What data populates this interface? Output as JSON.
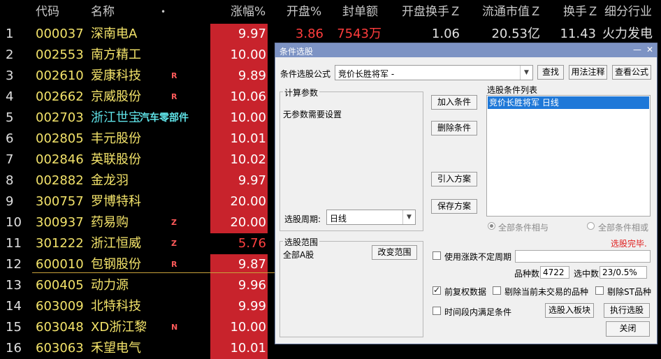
{
  "table": {
    "headers": {
      "code": "代码",
      "name": "名称",
      "dot": "•",
      "pct": "涨幅%",
      "open": "开盘%",
      "seal": "封单额",
      "turnover_open": "开盘换手Ｚ",
      "float_cap": "流通市值Ｚ",
      "turnover": "换手Ｚ",
      "industry": "细分行业"
    },
    "rows": [
      {
        "idx": "1",
        "code": "000037",
        "name": "深南电A",
        "tag": "",
        "pct": "9.97",
        "open": "3.86",
        "seal": "7543万",
        "turn_open": "1.06",
        "cap": "20.53亿",
        "hs": "11.43",
        "ind": "火力发电"
      },
      {
        "idx": "2",
        "code": "002553",
        "name": "南方精工",
        "tag": "",
        "pct": "10.00"
      },
      {
        "idx": "3",
        "code": "002610",
        "name": "爱康科技",
        "tag": "R",
        "pct": "9.89"
      },
      {
        "idx": "4",
        "code": "002662",
        "name": "京威股份",
        "tag": "R",
        "pct": "10.06"
      },
      {
        "idx": "5",
        "code": "002703",
        "name": "浙江世宝",
        "tag": "",
        "note": "汽车零部件",
        "pct": "10.00"
      },
      {
        "idx": "6",
        "code": "002805",
        "name": "丰元股份",
        "tag": "",
        "pct": "10.01"
      },
      {
        "idx": "7",
        "code": "002846",
        "name": "英联股份",
        "tag": "",
        "pct": "10.02"
      },
      {
        "idx": "8",
        "code": "002882",
        "name": "金龙羽",
        "tag": "",
        "pct": "9.97"
      },
      {
        "idx": "9",
        "code": "300757",
        "name": "罗博特科",
        "tag": "",
        "pct": "20.00"
      },
      {
        "idx": "10",
        "code": "300937",
        "name": "药易购",
        "tag": "Z",
        "pct": "20.00"
      },
      {
        "idx": "11",
        "code": "301222",
        "name": "浙江恒威",
        "tag": "Z",
        "pct": "5.76"
      },
      {
        "idx": "12",
        "code": "600010",
        "name": "包钢股份",
        "tag": "R",
        "pct": "9.87"
      },
      {
        "idx": "13",
        "code": "600405",
        "name": "动力源",
        "tag": "",
        "pct": "9.96"
      },
      {
        "idx": "14",
        "code": "603009",
        "name": "北特科技",
        "tag": "",
        "pct": "9.99"
      },
      {
        "idx": "15",
        "code": "603048",
        "name": "XD浙江黎",
        "tag": "N",
        "pct": "10.00"
      },
      {
        "idx": "16",
        "code": "603063",
        "name": "禾望电气",
        "tag": "",
        "pct": "10.01"
      }
    ]
  },
  "dialog": {
    "title": "条件选股",
    "min_icon": "—",
    "close_icon": "✕",
    "formula_label": "条件选股公式",
    "formula_value": "竞价长胜将军 -",
    "find_btn": "查找",
    "usage_btn": "用法注释",
    "view_btn": "查看公式",
    "calc_params_label": "计算参数",
    "no_params": "无参数需要设置",
    "period_label": "选股周期:",
    "period_value": "日线",
    "add_btn": "加入条件",
    "delete_btn": "删除条件",
    "import_btn": "引入方案",
    "save_btn": "保存方案",
    "list_label": "选股条件列表",
    "list_items": [
      "竞价长胜将军  日线"
    ],
    "radio_and": "全部条件相与",
    "radio_or": "全部条件相或",
    "status": "选股完毕.",
    "range_label": "选股范围",
    "range_value": "全部A股",
    "change_range_btn": "改变范围",
    "use_period_label": "使用涨跌不定周期",
    "count_label": "品种数",
    "count_value": "4722",
    "selected_label": "选中数",
    "selected_value": "23/0.5%",
    "adjusted_label": "前复权数据",
    "exclude_untraded_label": "剔除当前未交易的品种",
    "exclude_st_label": "剔除ST品种",
    "time_cond_label": "时间段内满足条件",
    "to_block_btn": "选股入板块",
    "run_btn": "执行选股",
    "close_btn": "关闭"
  }
}
